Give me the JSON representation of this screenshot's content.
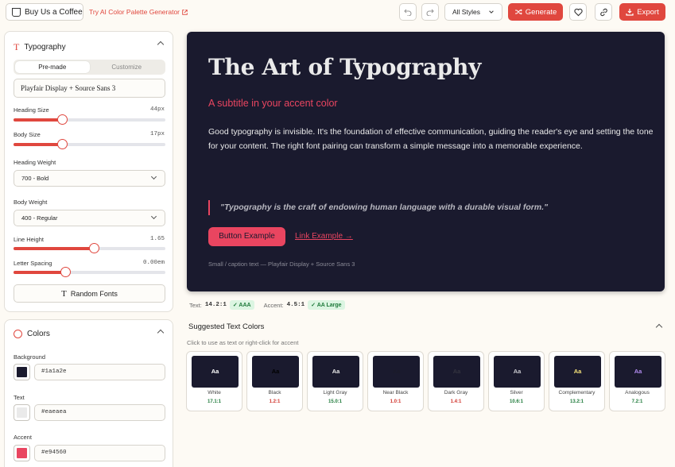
{
  "topbar": {
    "coffee_label": "Buy Us a Coffee",
    "ai_link": "Try AI Color Palette Generator",
    "styles_select": "All Styles",
    "generate_label": "Generate",
    "export_label": "Export"
  },
  "typography": {
    "title": "Typography",
    "tabs": [
      "Pre-made",
      "Customize"
    ],
    "active_tab": "Pre-made",
    "font_pair": "Playfair Display + Source Sans 3",
    "heading_size": {
      "label": "Heading Size",
      "value": "44px",
      "fraction": 0.32
    },
    "body_size": {
      "label": "Body Size",
      "value": "17px",
      "fraction": 0.32
    },
    "heading_weight": {
      "label": "Heading Weight",
      "value": "700 - Bold"
    },
    "body_weight": {
      "label": "Body Weight",
      "value": "400 - Regular"
    },
    "line_height": {
      "label": "Line Height",
      "value": "1.65",
      "fraction": 0.53
    },
    "letter_spacing": {
      "label": "Letter Spacing",
      "value": "0.00em",
      "fraction": 0.34
    },
    "random_label": "Random Fonts"
  },
  "colors": {
    "title": "Colors",
    "background": {
      "label": "Background",
      "hex": "#1a1a2e"
    },
    "text": {
      "label": "Text",
      "hex": "#eaeaea"
    },
    "accent": {
      "label": "Accent",
      "hex": "#e94560"
    }
  },
  "preview": {
    "title": "The Art of Typography",
    "subtitle": "A subtitle in your accent color",
    "body": "Good typography is invisible. It's the foundation of effective communication, guiding the reader's eye and setting the tone for your content. The right font pairing can transform a simple message into a memorable experience.",
    "quote": "\"Typography is the craft of endowing human language with a durable visual form.\"",
    "button": "Button Example",
    "link": "Link Example →",
    "small": "Small / caption text — Playfair Display + Source Sans 3"
  },
  "contrast": {
    "text_label": "Text:",
    "text_ratio": "14.2:1",
    "text_badge": "AAA",
    "accent_label": "Accent:",
    "accent_ratio": "4.5:1",
    "accent_badge": "AA Large"
  },
  "suggested": {
    "title": "Suggested Text Colors",
    "subtitle": "Click to use as text or right-click for accent",
    "sample": "Aa",
    "items": [
      {
        "name": "White",
        "ratio": "17.1:1",
        "color": "#ffffff",
        "ratio_color": "#1e7a3a"
      },
      {
        "name": "Black",
        "ratio": "1.2:1",
        "color": "#000000",
        "ratio_color": "#d0342c"
      },
      {
        "name": "Light Gray",
        "ratio": "15.0:1",
        "color": "#e8e8e8",
        "ratio_color": "#1e7a3a"
      },
      {
        "name": "Near Black",
        "ratio": "1.0:1",
        "color": "#1b1b2a",
        "ratio_color": "#d0342c"
      },
      {
        "name": "Dark Gray",
        "ratio": "1.4:1",
        "color": "#33333f",
        "ratio_color": "#d0342c"
      },
      {
        "name": "Silver",
        "ratio": "10.6:1",
        "color": "#c9c9cf",
        "ratio_color": "#1e7a3a"
      },
      {
        "name": "Complementary",
        "ratio": "13.2:1",
        "color": "#f5e27a",
        "ratio_color": "#1e7a3a"
      },
      {
        "name": "Analogous",
        "ratio": "7.2:1",
        "color": "#b28cf0",
        "ratio_color": "#1e7a3a"
      }
    ]
  }
}
